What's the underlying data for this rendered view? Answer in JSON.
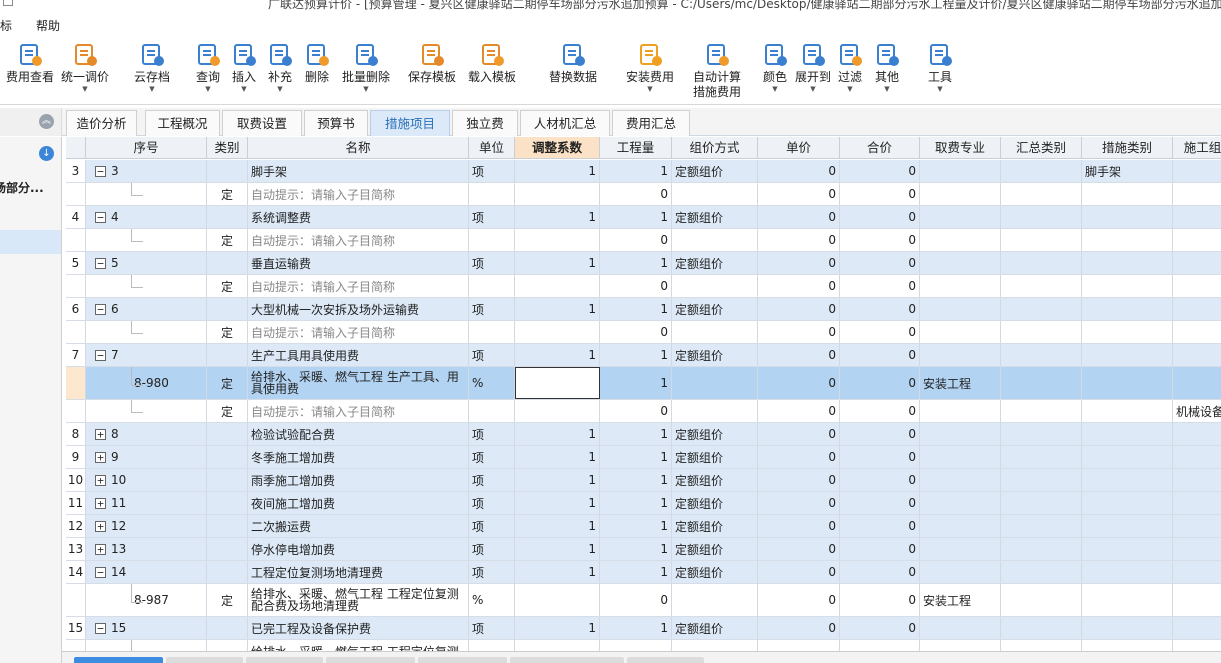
{
  "titlebar": {
    "title": "广联达预算计价 - [预算管理 - 夏兴区健康驿站二期停车场部分污水追加预算 - C:/Users/mc/Desktop/健康驿站二期部分污水工程量及计价/夏兴区健康驿站二期停车场部分污水追加预"
  },
  "menubar": {
    "items": [
      "标",
      "帮助"
    ]
  },
  "toolbar": {
    "buttons": [
      {
        "label": "费用查看",
        "icon": "fee-view-icon",
        "dropdown": false
      },
      {
        "label": "统一调价",
        "icon": "unified-price-icon",
        "dropdown": true
      },
      {
        "label": "云存档",
        "icon": "cloud-archive-icon",
        "dropdown": true
      },
      {
        "label": "查询",
        "icon": "query-icon",
        "dropdown": true
      },
      {
        "label": "插入",
        "icon": "insert-icon",
        "dropdown": true
      },
      {
        "label": "补充",
        "icon": "supplement-icon",
        "dropdown": true
      },
      {
        "label": "删除",
        "icon": "delete-icon",
        "dropdown": false
      },
      {
        "label": "批量删除",
        "icon": "batch-delete-icon",
        "dropdown": true
      },
      {
        "label": "保存模板",
        "icon": "save-template-icon",
        "dropdown": false
      },
      {
        "label": "载入模板",
        "icon": "load-template-icon",
        "dropdown": false
      },
      {
        "label": "替换数据",
        "icon": "replace-data-icon",
        "dropdown": false
      },
      {
        "label": "安装费用",
        "icon": "install-fee-icon",
        "dropdown": true
      },
      {
        "label": "自动计算",
        "label2": "措施费用",
        "icon": "auto-calc-icon",
        "dropdown": false
      },
      {
        "label": "颜色",
        "icon": "color-icon",
        "dropdown": true
      },
      {
        "label": "展开到",
        "icon": "expand-to-icon",
        "dropdown": true
      },
      {
        "label": "过滤",
        "icon": "filter-icon",
        "dropdown": true
      },
      {
        "label": "其他",
        "icon": "other-icon",
        "dropdown": true
      },
      {
        "label": "工具",
        "icon": "tools-icon",
        "dropdown": true
      }
    ]
  },
  "tabs": [
    {
      "label": "造价分析",
      "active": false
    },
    {
      "label": "工程概况",
      "active": false
    },
    {
      "label": "取费设置",
      "active": false
    },
    {
      "label": "预算书",
      "active": false
    },
    {
      "label": "措施项目",
      "active": true
    },
    {
      "label": "独立费",
      "active": false
    },
    {
      "label": "人材机汇总",
      "active": false
    },
    {
      "label": "费用汇总",
      "active": false
    }
  ],
  "leftpanel": {
    "node": "场部分..."
  },
  "grid": {
    "headers": [
      "",
      "序号",
      "类别",
      "名称",
      "单位",
      "调整系数",
      "工程量",
      "组价方式",
      "单价",
      "合价",
      "取费专业",
      "汇总类别",
      "措施类别",
      "施工组"
    ],
    "highlight_header": 5,
    "rows": [
      {
        "rn": "3",
        "seq": "3",
        "toggle": "−",
        "type": "",
        "name": "脚手架",
        "unit": "项",
        "coef": "1",
        "qty": "1",
        "method": "定额组价",
        "price": "0",
        "total": "0",
        "prof": "",
        "sumcat": "",
        "cat": "脚手架",
        "org": "",
        "style": "blue"
      },
      {
        "rn": "",
        "seq": "",
        "type": "定",
        "name": "自动提示：请输入子目简称",
        "hint": true,
        "unit": "",
        "coef": "",
        "qty": "0",
        "method": "",
        "price": "0",
        "total": "0",
        "prof": "",
        "sumcat": "",
        "cat": "",
        "org": "",
        "style": "white",
        "child": true
      },
      {
        "rn": "4",
        "seq": "4",
        "toggle": "−",
        "type": "",
        "name": "系统调整费",
        "unit": "项",
        "coef": "1",
        "qty": "1",
        "method": "定额组价",
        "price": "0",
        "total": "0",
        "prof": "",
        "sumcat": "",
        "cat": "",
        "org": "",
        "style": "blue"
      },
      {
        "rn": "",
        "seq": "",
        "type": "定",
        "name": "自动提示：请输入子目简称",
        "hint": true,
        "unit": "",
        "coef": "",
        "qty": "0",
        "method": "",
        "price": "0",
        "total": "0",
        "prof": "",
        "sumcat": "",
        "cat": "",
        "org": "",
        "style": "white",
        "child": true
      },
      {
        "rn": "5",
        "seq": "5",
        "toggle": "−",
        "type": "",
        "name": "垂直运输费",
        "unit": "项",
        "coef": "1",
        "qty": "1",
        "method": "定额组价",
        "price": "0",
        "total": "0",
        "prof": "",
        "sumcat": "",
        "cat": "",
        "org": "",
        "style": "blue"
      },
      {
        "rn": "",
        "seq": "",
        "type": "定",
        "name": "自动提示：请输入子目简称",
        "hint": true,
        "unit": "",
        "coef": "",
        "qty": "0",
        "method": "",
        "price": "0",
        "total": "0",
        "prof": "",
        "sumcat": "",
        "cat": "",
        "org": "",
        "style": "white",
        "child": true
      },
      {
        "rn": "6",
        "seq": "6",
        "toggle": "−",
        "type": "",
        "name": "大型机械一次安拆及场外运输费",
        "unit": "项",
        "coef": "1",
        "qty": "1",
        "method": "定额组价",
        "price": "0",
        "total": "0",
        "prof": "",
        "sumcat": "",
        "cat": "",
        "org": "",
        "style": "blue"
      },
      {
        "rn": "",
        "seq": "",
        "type": "定",
        "name": "自动提示：请输入子目简称",
        "hint": true,
        "unit": "",
        "coef": "",
        "qty": "0",
        "method": "",
        "price": "0",
        "total": "0",
        "prof": "",
        "sumcat": "",
        "cat": "",
        "org": "",
        "style": "white",
        "child": true
      },
      {
        "rn": "7",
        "seq": "7",
        "toggle": "−",
        "type": "",
        "name": "生产工具用具使用费",
        "unit": "项",
        "coef": "1",
        "qty": "1",
        "method": "定额组价",
        "price": "0",
        "total": "0",
        "prof": "",
        "sumcat": "",
        "cat": "",
        "org": "",
        "style": "blue"
      },
      {
        "rn": "",
        "seq": "8-980",
        "type": "定",
        "name": "给排水、采暖、燃气工程 生产工具、用具使用费",
        "unit": "%",
        "coef": "",
        "qty": "1",
        "method": "",
        "price": "0",
        "total": "0",
        "prof": "安装工程",
        "sumcat": "",
        "cat": "",
        "org": "",
        "style": "sel",
        "child": true,
        "tall": true,
        "edit": true
      },
      {
        "rn": "",
        "seq": "",
        "type": "定",
        "name": "自动提示：请输入子目简称",
        "hint": true,
        "unit": "",
        "coef": "",
        "qty": "0",
        "method": "",
        "price": "0",
        "total": "0",
        "prof": "",
        "sumcat": "",
        "cat": "",
        "org": "机械设备",
        "style": "white",
        "child": true
      },
      {
        "rn": "8",
        "seq": "8",
        "toggle": "+",
        "type": "",
        "name": "检验试验配合费",
        "unit": "项",
        "coef": "1",
        "qty": "1",
        "method": "定额组价",
        "price": "0",
        "total": "0",
        "prof": "",
        "sumcat": "",
        "cat": "",
        "org": "",
        "style": "blue"
      },
      {
        "rn": "9",
        "seq": "9",
        "toggle": "+",
        "type": "",
        "name": "冬季施工增加费",
        "unit": "项",
        "coef": "1",
        "qty": "1",
        "method": "定额组价",
        "price": "0",
        "total": "0",
        "prof": "",
        "sumcat": "",
        "cat": "",
        "org": "",
        "style": "blue"
      },
      {
        "rn": "10",
        "seq": "10",
        "toggle": "+",
        "type": "",
        "name": "雨季施工增加费",
        "unit": "项",
        "coef": "1",
        "qty": "1",
        "method": "定额组价",
        "price": "0",
        "total": "0",
        "prof": "",
        "sumcat": "",
        "cat": "",
        "org": "",
        "style": "blue"
      },
      {
        "rn": "11",
        "seq": "11",
        "toggle": "+",
        "type": "",
        "name": "夜间施工增加费",
        "unit": "项",
        "coef": "1",
        "qty": "1",
        "method": "定额组价",
        "price": "0",
        "total": "0",
        "prof": "",
        "sumcat": "",
        "cat": "",
        "org": "",
        "style": "blue"
      },
      {
        "rn": "12",
        "seq": "12",
        "toggle": "+",
        "type": "",
        "name": "二次搬运费",
        "unit": "项",
        "coef": "1",
        "qty": "1",
        "method": "定额组价",
        "price": "0",
        "total": "0",
        "prof": "",
        "sumcat": "",
        "cat": "",
        "org": "",
        "style": "blue"
      },
      {
        "rn": "13",
        "seq": "13",
        "toggle": "+",
        "type": "",
        "name": "停水停电增加费",
        "unit": "项",
        "coef": "1",
        "qty": "1",
        "method": "定额组价",
        "price": "0",
        "total": "0",
        "prof": "",
        "sumcat": "",
        "cat": "",
        "org": "",
        "style": "blue"
      },
      {
        "rn": "14",
        "seq": "14",
        "toggle": "−",
        "type": "",
        "name": "工程定位复测场地清理费",
        "unit": "项",
        "coef": "1",
        "qty": "1",
        "method": "定额组价",
        "price": "0",
        "total": "0",
        "prof": "",
        "sumcat": "",
        "cat": "",
        "org": "",
        "style": "blue"
      },
      {
        "rn": "",
        "seq": "8-987",
        "type": "定",
        "name": "给排水、采暖、燃气工程 工程定位复测配合费及场地清理费",
        "unit": "%",
        "coef": "",
        "qty": "0",
        "method": "",
        "price": "0",
        "total": "0",
        "prof": "安装工程",
        "sumcat": "",
        "cat": "",
        "org": "",
        "style": "white",
        "child": true,
        "tall": true
      },
      {
        "rn": "15",
        "seq": "15",
        "toggle": "−",
        "type": "",
        "name": "已完工程及设备保护费",
        "unit": "项",
        "coef": "1",
        "qty": "1",
        "method": "定额组价",
        "price": "0",
        "total": "0",
        "prof": "",
        "sumcat": "",
        "cat": "",
        "org": "",
        "style": "blue"
      },
      {
        "rn": "",
        "seq": "",
        "type": "",
        "name": "给排水、采暖、燃气工程 工程定位复测",
        "unit": "",
        "coef": "",
        "qty": "",
        "method": "",
        "price": "",
        "total": "",
        "prof": "",
        "sumcat": "",
        "cat": "",
        "org": "",
        "style": "white",
        "child": true
      }
    ]
  },
  "colors": {
    "accent": "#2a6fb8",
    "row_blue": "#dde9f7",
    "row_selected": "#b3d3f3",
    "header_highlight": "#fbe1c5"
  }
}
